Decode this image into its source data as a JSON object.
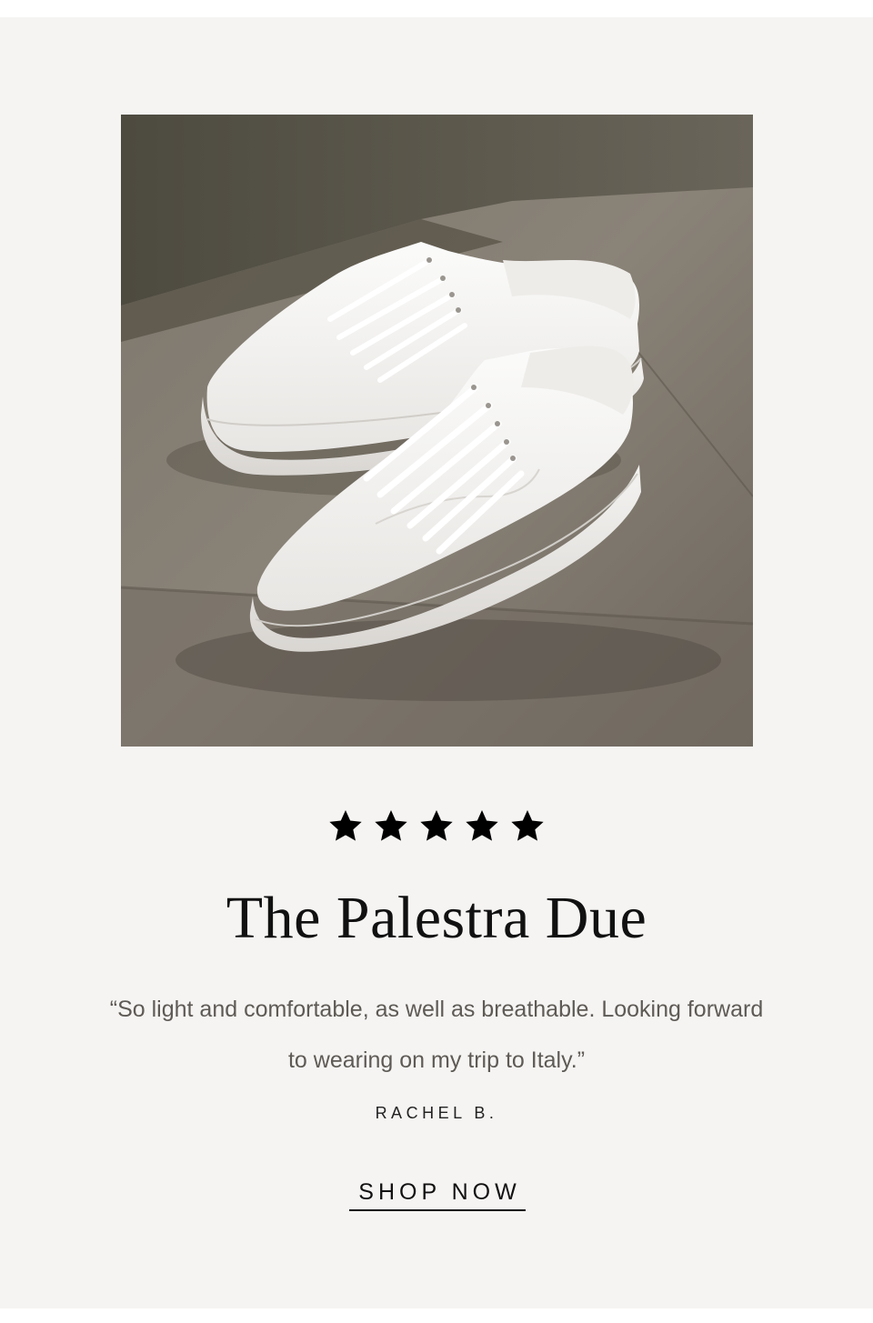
{
  "product": {
    "rating_stars": 5,
    "title": "The Palestra Due",
    "image_subject": "white-leather-sneakers-photo"
  },
  "review": {
    "quote": "“So light and comfortable, as well as breathable. Looking forward to wearing on my trip to Italy.”",
    "author": "RACHEL B."
  },
  "cta": {
    "label": "SHOP NOW"
  },
  "colors": {
    "card_background": "#f5f4f2",
    "text_primary": "#111111",
    "text_quote": "#5e5a55",
    "star": "#000000"
  }
}
